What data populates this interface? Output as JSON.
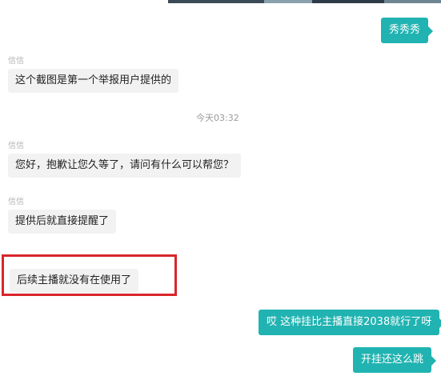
{
  "conversation": {
    "messages": [
      {
        "direction": "out",
        "text": "秀秀秀"
      },
      {
        "direction": "in",
        "sender": "信信",
        "text": "这个截图是第一个举报用户提供的"
      },
      {
        "direction": "in",
        "sender": "信信",
        "text": "您好，抱歉让您久等了，请问有什么可以帮您？"
      },
      {
        "direction": "in",
        "sender": "信信",
        "text": "提供后就直接提醒了"
      },
      {
        "direction": "in",
        "sender": "信信",
        "text": "后续主播就没有在使用了"
      },
      {
        "direction": "out",
        "text": "哎 这种挂比主播直接2038就行了呀"
      },
      {
        "direction": "out",
        "text": "开挂还这么跳"
      }
    ],
    "timestamp": "今天03:32"
  },
  "colors": {
    "outgoing_bubble": "#20b3b1",
    "incoming_bubble": "#f2f2f2",
    "highlight_box": "#d9252b"
  }
}
